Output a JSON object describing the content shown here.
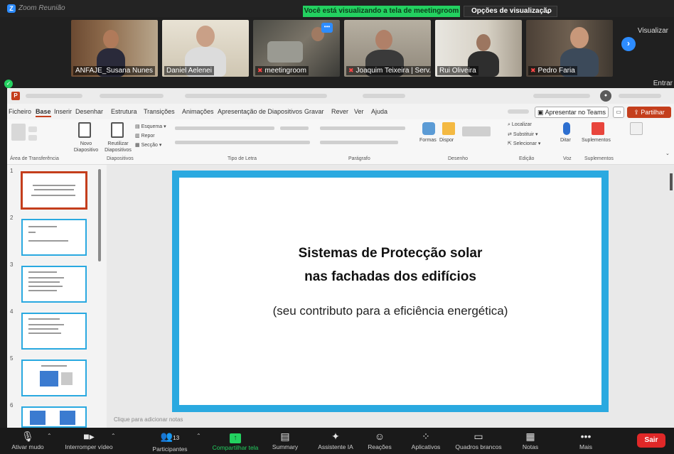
{
  "zoom": {
    "window_title": "Zoom Reunião",
    "share_banner": "Você está visualizando a tela de meetingroom",
    "view_options": "Opções de visualização",
    "visualizar": "Visualizar",
    "entrar": "Entrar"
  },
  "participants": [
    {
      "name": "ANFAJE_Susana Nunes",
      "muted": false
    },
    {
      "name": "Daniel Aelenei",
      "muted": false
    },
    {
      "name": "meetingroom",
      "muted": true
    },
    {
      "name": "Joaquim Teixeira | Serv...",
      "muted": true
    },
    {
      "name": "Rui Oliveira",
      "muted": false
    },
    {
      "name": "Pedro Faria",
      "muted": true
    }
  ],
  "ppt": {
    "menu": [
      "Ficheiro",
      "Base",
      "Inserir",
      "Desenhar",
      "Estrutura",
      "Transições",
      "Animações",
      "Apresentação de Diapositivos",
      "Gravar",
      "Rever",
      "Ver",
      "Ajuda"
    ],
    "active_menu": "Base",
    "present_teams": "Apresentar no Teams",
    "share": "Partilhar",
    "ribbon": {
      "clipboard": "Área de Transferência",
      "new_slide": "Novo Diapositivo",
      "reuse_slides": "Reutilizar Diapositivos",
      "layout": "Esquema",
      "reset": "Repor",
      "section": "Secção",
      "slides_group": "Diapositivos",
      "font_group": "Tipo de Letra",
      "paragraph_group": "Parágrafo",
      "shapes": "Formas",
      "arrange": "Dispor",
      "drawing_group": "Desenho",
      "find": "Localizar",
      "replace": "Substituir",
      "select": "Selecionar",
      "editing_group": "Edição",
      "dictate": "Ditar",
      "voice_group": "Voz",
      "addins": "Suplementos",
      "addins_group": "Suplementos"
    },
    "slide_numbers": [
      "1",
      "2",
      "3",
      "4",
      "5",
      "6"
    ],
    "slide": {
      "title_line1": "Sistemas de Protecção solar",
      "title_line2": "nas fachadas dos edifícios",
      "subtitle": "(seu contributo para a eficiência energética)"
    },
    "notes_placeholder": "Clique para adicionar notas"
  },
  "toolbar": {
    "mute": "Ativar mudo",
    "stop_video": "Interromper vídeo",
    "participants": "Participantes",
    "participants_count": "13",
    "share_screen": "Compartilhar tela",
    "summary": "Summary",
    "ai_assistant": "Assistente IA",
    "reactions": "Reações",
    "apps": "Aplicativos",
    "whiteboards": "Quadros brancos",
    "notes": "Notas",
    "more": "Mais",
    "leave": "Sair"
  },
  "colors": {
    "zoom_green": "#23d160",
    "zoom_blue": "#2d8cff",
    "ppt_accent": "#c43e1c",
    "slide_border": "#2aa9e0",
    "leave_red": "#e02828"
  }
}
